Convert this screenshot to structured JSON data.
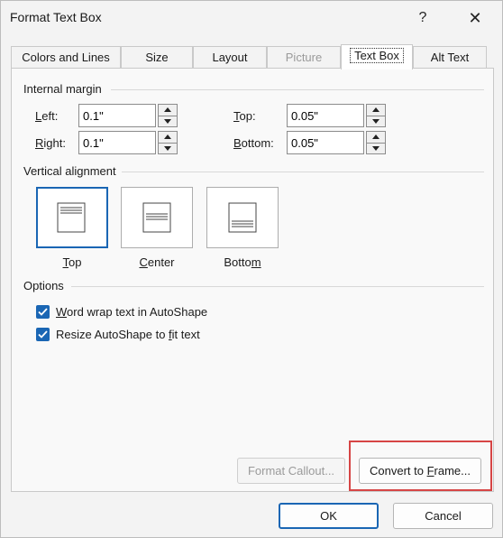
{
  "window": {
    "title": "Format Text Box",
    "help_label": "?",
    "close_label": "✕"
  },
  "tabs": [
    {
      "label": "Colors and Lines",
      "state": "normal"
    },
    {
      "label": "Size",
      "state": "normal"
    },
    {
      "label": "Layout",
      "state": "normal"
    },
    {
      "label": "Picture",
      "state": "disabled"
    },
    {
      "label": "Text Box",
      "state": "active"
    },
    {
      "label": "Alt Text",
      "state": "normal"
    }
  ],
  "internal_margin": {
    "heading": "Internal margin",
    "left": {
      "label_key": "L",
      "label_rest": "eft:",
      "value": "0.1\""
    },
    "right": {
      "label_key": "R",
      "label_rest": "ight:",
      "value": "0.1\""
    },
    "top": {
      "label_key": "T",
      "label_rest": "op:",
      "value": "0.05\""
    },
    "bottom": {
      "label_key": "B",
      "label_rest": "ottom:",
      "value": "0.05\""
    }
  },
  "vertical_alignment": {
    "heading": "Vertical alignment",
    "options": [
      {
        "label_key": "T",
        "label_rest": "op",
        "selected": true
      },
      {
        "label_key": "C",
        "label_rest": "enter",
        "selected": false
      },
      {
        "label_pre": "Botto",
        "label_key": "m",
        "selected": false
      }
    ]
  },
  "options": {
    "heading": "Options",
    "word_wrap": {
      "label_key": "W",
      "label_rest": "ord wrap text in AutoShape",
      "checked": true
    },
    "resize": {
      "label_pre": "Resize AutoShape to ",
      "label_key": "f",
      "label_rest": "it text",
      "checked": true
    }
  },
  "buttons": {
    "format_callout": "Format Callout...",
    "convert_pre": "Convert to ",
    "convert_key": "F",
    "convert_rest": "rame...",
    "ok": "OK",
    "cancel": "Cancel"
  },
  "colors": {
    "accent": "#1a66b4",
    "highlight": "#d64545"
  }
}
